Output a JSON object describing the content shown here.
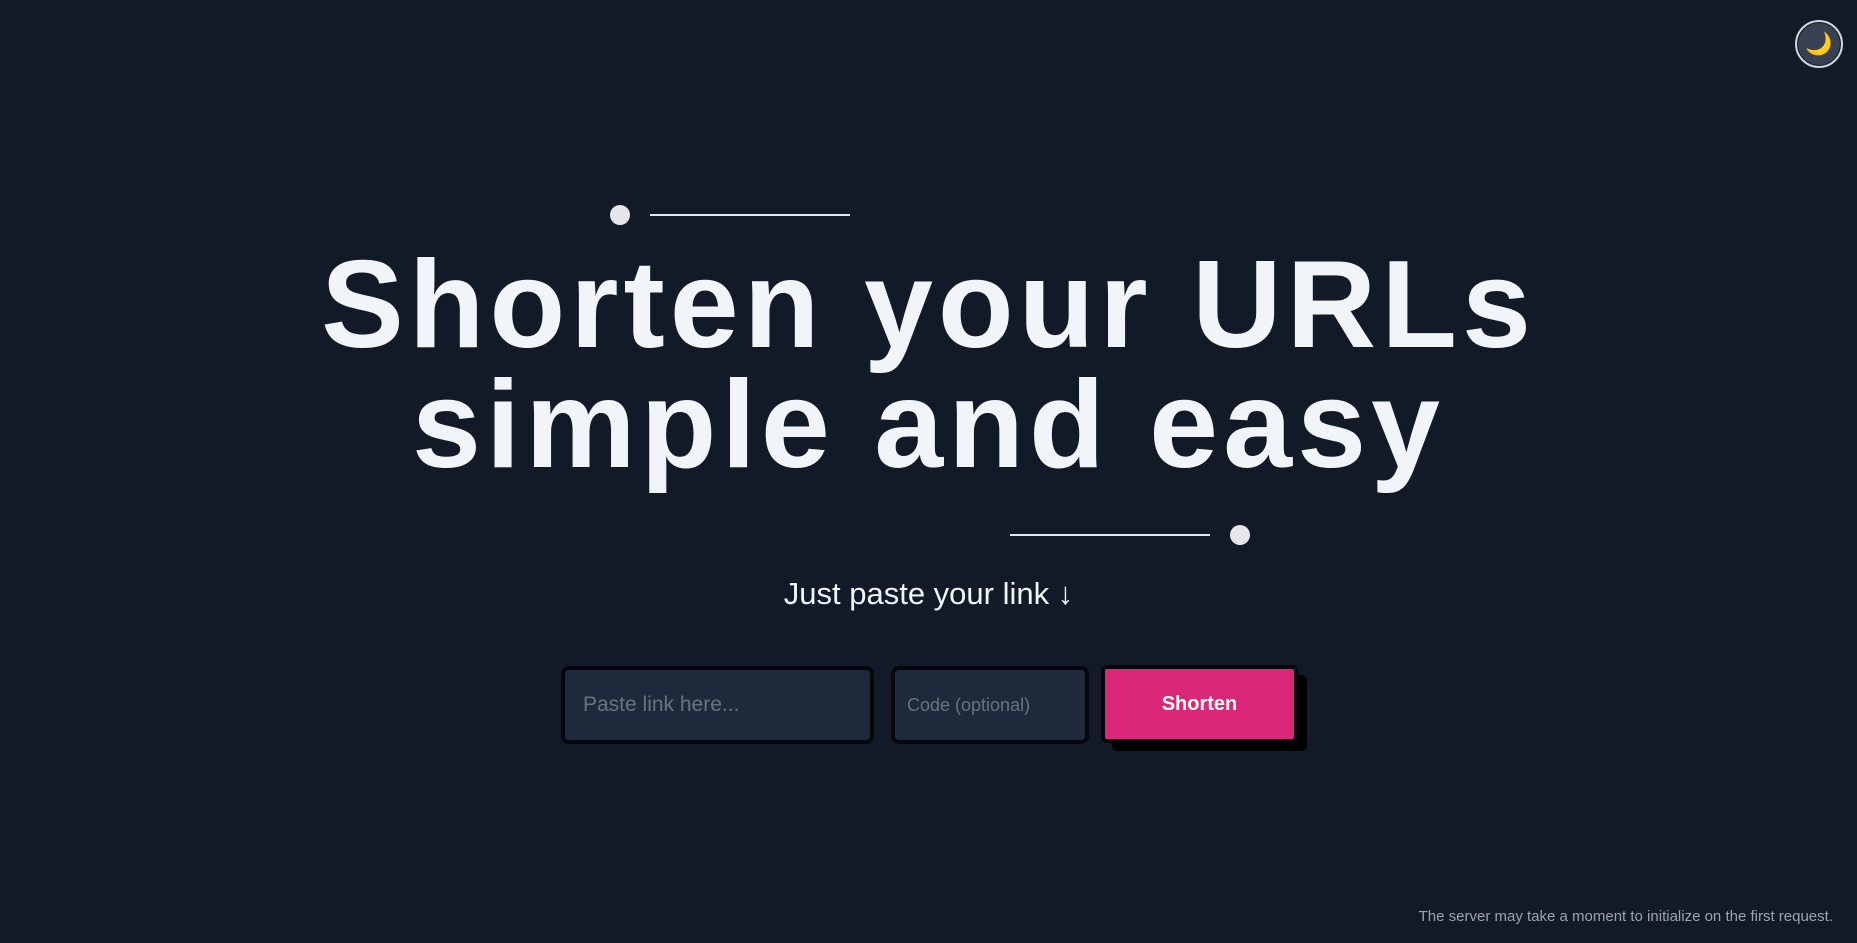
{
  "theme_toggle": {
    "icon": "moon-icon",
    "glyph": "🌙"
  },
  "hero": {
    "title_line1": "Shorten your URLs",
    "title_line2": "simple and easy"
  },
  "subtitle": "Just paste your link ↓",
  "form": {
    "url_placeholder": "Paste link here...",
    "url_value": "",
    "code_placeholder": "Code (optional)",
    "code_value": "",
    "submit_label": "Shorten"
  },
  "footer": {
    "note": "The server may take a moment to initialize on the first request."
  },
  "colors": {
    "background": "#121a28",
    "accent": "#db2777",
    "text": "#f1f5f9",
    "field_bg": "#1e293b"
  }
}
